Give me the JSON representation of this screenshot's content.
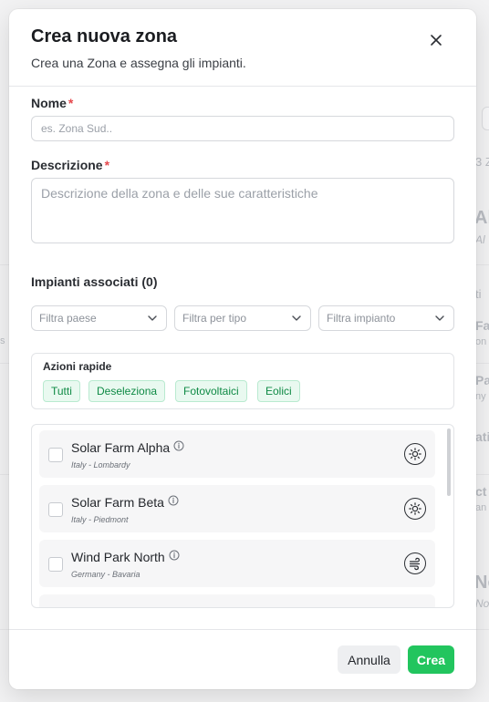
{
  "modal": {
    "title": "Crea nuova zona",
    "subtitle": "Crea una Zona e assegna gli impianti."
  },
  "form": {
    "name_label": "Nome",
    "name_placeholder": "es. Zona Sud..",
    "description_label": "Descrizione",
    "description_placeholder": "Descrizione della zona e delle sue caratteristiche",
    "required_mark": "*"
  },
  "plants": {
    "section_title": "Impianti associati (0)",
    "filters": [
      {
        "label": "Filtra paese"
      },
      {
        "label": "Filtra per tipo"
      },
      {
        "label": "Filtra impianto"
      }
    ],
    "quick_actions_title": "Azioni rapide",
    "quick_actions": [
      "Tutti",
      "Deseleziona",
      "Fotovoltaici",
      "Eolici"
    ],
    "items": [
      {
        "name": "Solar Farm Alpha",
        "location": "Italy - Lombardy",
        "type_icon": "sun-icon"
      },
      {
        "name": "Solar Farm Beta",
        "location": "Italy - Piedmont",
        "type_icon": "sun-icon"
      },
      {
        "name": "Wind Park North",
        "location": "Germany - Bavaria",
        "type_icon": "wind-icon"
      }
    ]
  },
  "footer": {
    "cancel_label": "Annulla",
    "create_label": "Crea"
  },
  "colors": {
    "accent": "#22c55e",
    "chip_bg": "#e9f9f0",
    "chip_text": "#0f8a45",
    "required": "#e5484d"
  },
  "background": {
    "fragments": [
      "3 Z",
      "Al",
      "Al",
      "ti",
      "Fa",
      "on",
      "Pa",
      "ny",
      "ati",
      "ct",
      "an",
      "Nc",
      "No",
      "s"
    ]
  }
}
